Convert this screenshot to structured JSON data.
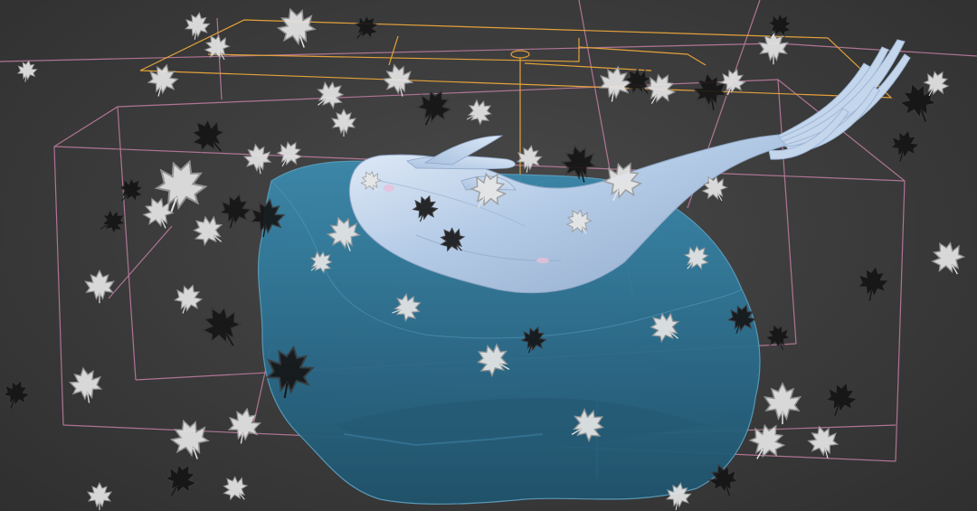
{
  "viewport": {
    "view_type": "perspective-3d-viewport",
    "scene_objects": [
      "cage-wireframe",
      "plane-helper",
      "water-block",
      "fish-sculpture",
      "falling-leaves"
    ]
  },
  "colors": {
    "background": "#3b3b3b",
    "cage_wire": "#c97fa6",
    "plane_wire": "#e3a23a",
    "water_body": "#2f6f8d",
    "water_edge": "#4d8fab",
    "fish_body": "#aec6e4",
    "fish_highlight": "#e5eef9",
    "leaf_light": "#e6e6e6",
    "leaf_dark": "#141414",
    "leaf_mid": "#9a9a9a"
  }
}
